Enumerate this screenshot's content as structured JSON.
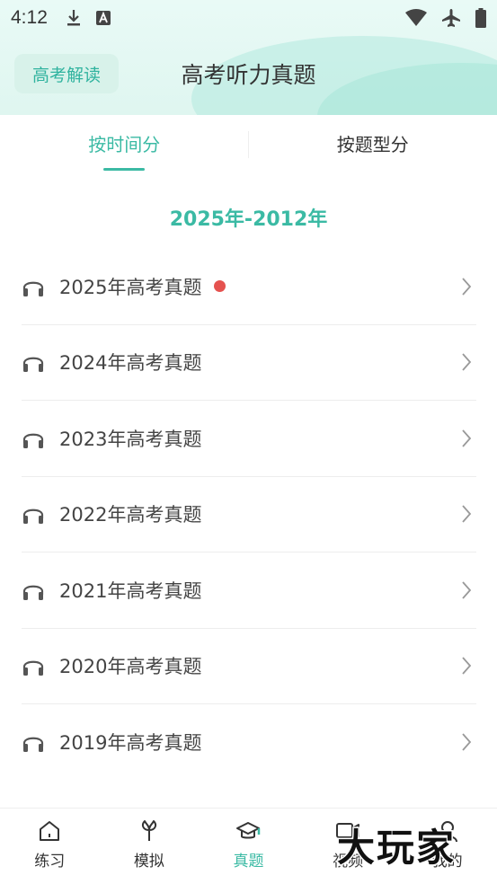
{
  "status_bar": {
    "time": "4:12"
  },
  "header": {
    "tag_button": "高考解读",
    "title": "高考听力真题"
  },
  "tabs": [
    {
      "label": "按时间分",
      "active": true
    },
    {
      "label": "按题型分",
      "active": false
    }
  ],
  "section_heading": "2025年-2012年",
  "papers": [
    {
      "label": "2025年高考真题",
      "new": true
    },
    {
      "label": "2024年高考真题",
      "new": false
    },
    {
      "label": "2023年高考真题",
      "new": false
    },
    {
      "label": "2022年高考真题",
      "new": false
    },
    {
      "label": "2021年高考真题",
      "new": false
    },
    {
      "label": "2020年高考真题",
      "new": false
    },
    {
      "label": "2019年高考真题",
      "new": false
    }
  ],
  "bottom_nav": [
    {
      "label": "练习",
      "icon": "home-icon",
      "active": false
    },
    {
      "label": "模拟",
      "icon": "leaf-icon",
      "active": false
    },
    {
      "label": "真题",
      "icon": "graduation-cap-icon",
      "active": true
    },
    {
      "label": "视频",
      "icon": "video-icon",
      "active": false
    },
    {
      "label": "我的",
      "icon": "user-icon",
      "active": false
    }
  ],
  "watermark": "大玩家",
  "colors": {
    "accent": "#3bbaa4",
    "badge": "#e5524f",
    "header_bg": "#e9faf6"
  }
}
